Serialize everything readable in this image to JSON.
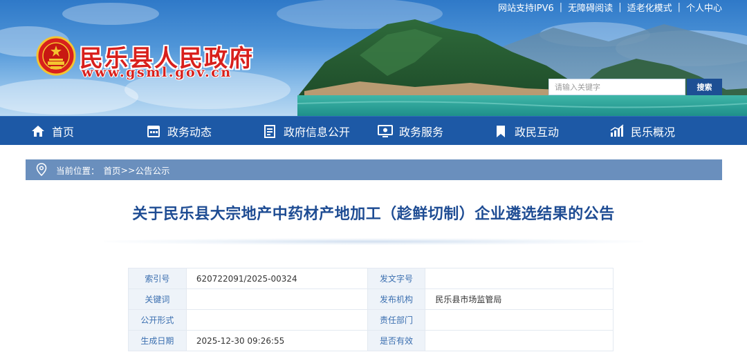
{
  "header": {
    "top_links": [
      "网站支持IPV6",
      "无障碍阅读",
      "适老化模式",
      "个人中心"
    ],
    "site_name": "民乐县人民政府",
    "site_url": "www.gsml.gov.cn",
    "search": {
      "placeholder": "请输入关键字",
      "button_label": "搜索"
    }
  },
  "nav": {
    "items": [
      {
        "label": "首页",
        "icon": "home-icon"
      },
      {
        "label": "政务动态",
        "icon": "calendar-icon"
      },
      {
        "label": "政府信息公开",
        "icon": "document-list-icon"
      },
      {
        "label": "政务服务",
        "icon": "monitor-icon"
      },
      {
        "label": "政民互动",
        "icon": "bookmark-icon"
      },
      {
        "label": "民乐概况",
        "icon": "bar-chart-icon"
      }
    ]
  },
  "breadcrumb": {
    "lead": "当前位置：",
    "home": "首页",
    "separator": ">>",
    "current": "公告公示"
  },
  "article": {
    "title": "关于民乐县大宗地产中药材产地加工（趁鲜切制）企业遴选结果的公告"
  },
  "meta": {
    "rows": [
      {
        "k1": "索引号",
        "v1": "620722091/2025-00324",
        "k2": "发文字号",
        "v2": ""
      },
      {
        "k1": "关键词",
        "v1": "",
        "k2": "发布机构",
        "v2": "民乐县市场监管局"
      },
      {
        "k1": "公开形式",
        "v1": "",
        "k2": "责任部门",
        "v2": ""
      },
      {
        "k1": "生成日期",
        "v1": "2025-12-30 09:26:55",
        "k2": "是否有效",
        "v2": ""
      }
    ]
  },
  "colors": {
    "nav_bg": "#1d59a6",
    "title_red": "#d8201c",
    "article_title_blue": "#1e4c93",
    "breadcrumb_bg": "#6a8fbd",
    "table_key_bg": "#eef3f9"
  }
}
